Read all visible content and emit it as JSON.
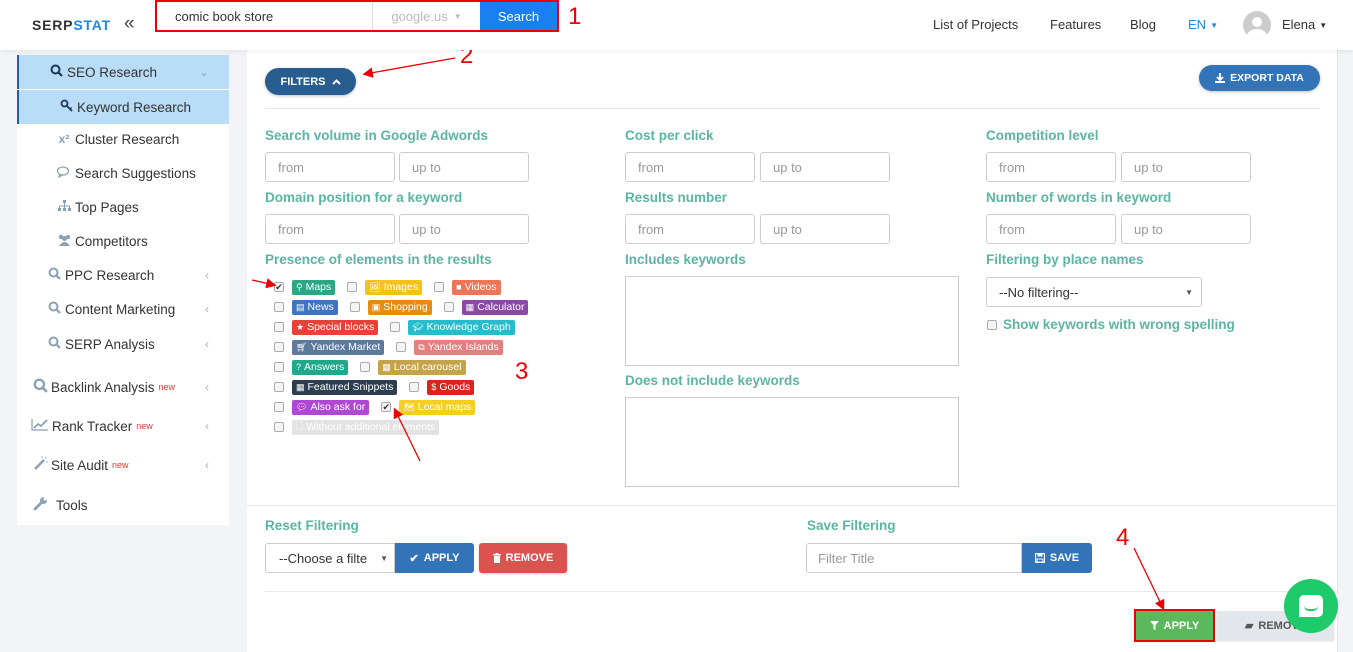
{
  "header": {
    "logo_main": "SERP",
    "logo_accent": "STAT",
    "collapse_icon": "«",
    "search": {
      "query": "comic book store",
      "engine": "google.us",
      "button": "Search"
    },
    "nav": [
      "List of Projects",
      "Features",
      "Blog"
    ],
    "language": "EN",
    "user": "Elena"
  },
  "sidebar": {
    "items": [
      {
        "label": "SEO Research",
        "icon": "search-icon",
        "glyph": "🔍︎",
        "state": "expanded"
      },
      {
        "label": "Keyword Research",
        "icon": "key-icon",
        "glyph": "🔑︎",
        "state": "active"
      },
      {
        "label": "Cluster Research",
        "icon": "superscript-icon",
        "glyph": "x²"
      },
      {
        "label": "Search Suggestions",
        "icon": "comments-icon",
        "glyph": "💬︎"
      },
      {
        "label": "Top Pages",
        "icon": "sitemap-icon",
        "glyph": "⊞"
      },
      {
        "label": "Competitors",
        "icon": "users-icon",
        "glyph": "👥︎"
      },
      {
        "label": "PPC Research",
        "icon": "search-icon",
        "glyph": "🔍︎"
      },
      {
        "label": "Content Marketing",
        "icon": "search-icon",
        "glyph": "🔍︎"
      },
      {
        "label": "SERP Analysis",
        "icon": "search-icon",
        "glyph": "🔍︎"
      },
      {
        "label": "Backlink Analysis",
        "icon": "search-icon",
        "glyph": "🔍︎",
        "badge": "new"
      },
      {
        "label": "Rank Tracker",
        "icon": "line-chart-icon",
        "glyph": "📈︎",
        "badge": "new"
      },
      {
        "label": "Site Audit",
        "icon": "magic-wand-icon",
        "glyph": "✎",
        "badge": "new"
      },
      {
        "label": "Tools",
        "icon": "wrench-icon",
        "glyph": "🔧︎"
      }
    ]
  },
  "toolbar": {
    "filters": "FILTERS",
    "export": "EXPORT DATA"
  },
  "filters": {
    "search_volume": {
      "label": "Search volume in Google Adwords",
      "from": "from",
      "to": "up to"
    },
    "cost_per_click": {
      "label": "Cost per click",
      "from": "from",
      "to": "up to"
    },
    "competition": {
      "label": "Competition level",
      "from": "from",
      "to": "up to"
    },
    "domain_position": {
      "label": "Domain position for a keyword",
      "from": "from",
      "to": "up to"
    },
    "results_number": {
      "label": "Results number",
      "from": "from",
      "to": "up to"
    },
    "words_number": {
      "label": "Number of words in keyword",
      "from": "from",
      "to": "up to"
    },
    "presence_label": "Presence of elements in the results",
    "includes_label": "Includes keywords",
    "excludes_label": "Does not include keywords",
    "place_label": "Filtering by place names",
    "place_value": "--No filtering--",
    "spelling_label": "Show keywords with wrong spelling",
    "spelling_checked": false,
    "elements": [
      [
        {
          "label": "Maps",
          "color": "#2aa785",
          "glyph": "⚲",
          "checked": true
        },
        {
          "label": "Images",
          "color": "#f4c21b",
          "glyph": "🖼︎",
          "checked": false
        },
        {
          "label": "Videos",
          "color": "#ef7458",
          "glyph": "■",
          "checked": false
        }
      ],
      [
        {
          "label": "News",
          "color": "#3f74c4",
          "glyph": "▤",
          "checked": false
        },
        {
          "label": "Shopping",
          "color": "#e88a14",
          "glyph": "▣",
          "checked": false
        },
        {
          "label": "Calculator",
          "color": "#8a49a8",
          "glyph": "▦",
          "checked": false
        }
      ],
      [
        {
          "label": "Special blocks",
          "color": "#e8413a",
          "glyph": "★",
          "checked": false
        },
        {
          "label": "Knowledge Graph",
          "color": "#26bccb",
          "glyph": "🎓︎",
          "checked": false
        }
      ],
      [
        {
          "label": "Yandex Market",
          "color": "#5d7a9c",
          "glyph": "🛒︎",
          "checked": false
        },
        {
          "label": "Yandex Islands",
          "color": "#e57f7f",
          "glyph": "⧉",
          "checked": false
        }
      ],
      [
        {
          "label": "Answers",
          "color": "#1ea98b",
          "glyph": "?",
          "checked": false
        },
        {
          "label": "Local carousel",
          "color": "#c4a34a",
          "glyph": "▦",
          "checked": false
        }
      ],
      [
        {
          "label": "Featured Snippets",
          "color": "#2c3e50",
          "glyph": "▦",
          "checked": false
        },
        {
          "label": "Goods",
          "color": "#d9251c",
          "glyph": "$",
          "checked": false
        }
      ],
      [
        {
          "label": "Also ask for",
          "color": "#b048d6",
          "glyph": "💬︎",
          "checked": false
        },
        {
          "label": "Local maps",
          "color": "#f4cf22",
          "glyph": "🗺︎",
          "checked": true
        }
      ],
      [
        {
          "label": "Without additional elements",
          "color": "#e3e3e3",
          "glyph": "🗋︎",
          "checked": false
        }
      ]
    ]
  },
  "reset": {
    "label": "Reset Filtering",
    "select": "--Choose a filte",
    "apply": "APPLY",
    "remove": "REMOVE"
  },
  "save": {
    "label": "Save Filtering",
    "placeholder": "Filter Title",
    "button": "SAVE"
  },
  "footer_actions": {
    "apply": "APPLY",
    "remove": "REMOVE"
  },
  "annotations": [
    "1",
    "2",
    "3",
    "4"
  ],
  "colors": {
    "brand_blue": "#1e88e5",
    "label_teal": "#5bb5a2",
    "filters_navy": "#275d8f",
    "primary_blue": "#3373b8",
    "danger_red": "#d9534f",
    "success_green": "#5cb85c",
    "chat_green": "#1fca6a",
    "annotation_red": "#ee0000"
  }
}
